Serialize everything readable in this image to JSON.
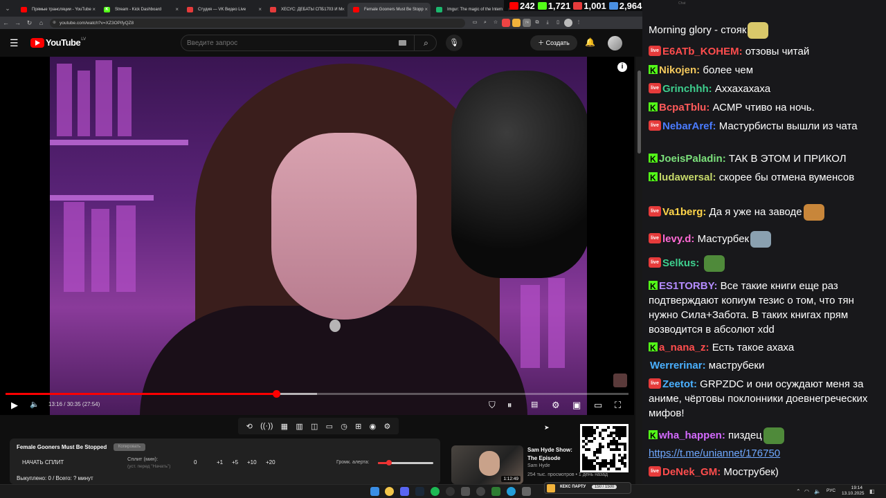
{
  "browser": {
    "tabs": [
      {
        "label": "Прямые трансляции - YouTube",
        "favicon_color": "#ff0000",
        "fav": ""
      },
      {
        "label": "Stream - Kick Dashboard",
        "favicon_color": "#53fc18",
        "fav": "K"
      },
      {
        "label": "Студия — VK Видео Live",
        "favicon_color": "#e63b3b",
        "fav": ""
      },
      {
        "label": "ХЕСУС: ДЕБАТЫ СПБ1703 И М",
        "favicon_color": "#e63b3b",
        "fav": ""
      },
      {
        "label": "Female Gooners Must Be Stopp",
        "favicon_color": "#ff0000",
        "fav": ""
      },
      {
        "label": "Imgur: The magic of the Intern",
        "favicon_color": "#1bb76e",
        "fav": ""
      }
    ],
    "url": "youtube.com/watch?v=XZ3OPifyQZ8",
    "ext_badge": "74"
  },
  "youtube": {
    "logo": "YouTube",
    "country": "LV",
    "search_placeholder": "Введите запрос",
    "create_label": "Создать",
    "player": {
      "time_label": "13:16 / 30:35 (27:54)",
      "played_fraction": 0.434,
      "loaded_fraction": 0.5
    }
  },
  "below": {
    "title": "Female Gooners Must Be Stopped",
    "title_btn": "Копировать",
    "split_start": "НАЧАТЬ СПЛИТ",
    "split_label": "Сплит (мин):",
    "split_sub": "(уст. перед \"Начать\")",
    "split_value": "0",
    "increments": [
      "+1",
      "+5",
      "+10",
      "+20"
    ],
    "alert_label": "Громк. алерта:",
    "alert_fraction": 0.2,
    "wasted": "Выкуплено: 0 / Всего: ? минут"
  },
  "recommended": {
    "title": "Sam Hyde Show: The Episode",
    "channel": "Sam Hyde",
    "meta": "254 тыс. просмотров • 1 день назад",
    "duration": "1:12:49"
  },
  "stats": [
    {
      "platform": "youtube",
      "color": "#ff0000",
      "value": "242"
    },
    {
      "platform": "kick",
      "color": "#53fc18",
      "value": "1,721"
    },
    {
      "platform": "vk",
      "color": "#e63b3b",
      "value": "1,001"
    },
    {
      "platform": "total",
      "color": "#4a90e2",
      "value": "2,964"
    }
  ],
  "chat": {
    "title": "Chat",
    "messages": [
      {
        "platform": "none",
        "user": "",
        "color": "#ffffff",
        "text": "Morning glory - стояк",
        "emote": "#d9c86a"
      },
      {
        "platform": "vk",
        "user": "E6ATb_KOHEM:",
        "color": "#ff4d4d",
        "text": " отзовы читай",
        "emote": ""
      },
      {
        "platform": "kick",
        "user": "Nikojen:",
        "color": "#f4c95d",
        "text": " более чем",
        "emote": ""
      },
      {
        "platform": "vk",
        "user": "Grinchhh:",
        "color": "#3ecf8e",
        "text": " Аххахахаха",
        "emote": ""
      },
      {
        "platform": "kick",
        "user": "BcpaTblu:",
        "color": "#ff5a5a",
        "text": " АСМР чтиво на ночь.",
        "emote": ""
      },
      {
        "platform": "vk",
        "user": "NebarAref:",
        "color": "#4a7bff",
        "text": " Мастурбисты вышли из чата",
        "emote": ""
      },
      {
        "platform": "kick",
        "user": "JoeisPaladin:",
        "color": "#7be07b",
        "text": " ТАК В ЭТОМ И ПРИКОЛ",
        "emote": ""
      },
      {
        "platform": "kick",
        "user": "ludawersal:",
        "color": "#c6d96a",
        "text": " скорее бы отмена вуменсов",
        "emote": ""
      },
      {
        "platform": "vk",
        "user": "Va1berg:",
        "color": "#ffd54a",
        "text": " Да я уже на заводе",
        "emote": "#c8863a"
      },
      {
        "platform": "vk",
        "user": "levy.d:",
        "color": "#ff6ad5",
        "text": " Мастурбек",
        "emote": "#8aa0b0"
      },
      {
        "platform": "vk",
        "user": "Selkus:",
        "color": "#3ecf8e",
        "text": " ",
        "emote": "#4f8a3a"
      },
      {
        "platform": "kick",
        "user": "ES1TORBY:",
        "color": "#b48cff",
        "text": " Все такие книги еще раз подтверждают копиум тезис о том, что тян нужно Сила+Забота. В таких книгах прям возводится в абсолют xdd",
        "emote": ""
      },
      {
        "platform": "kick",
        "user": "a_nana_z:",
        "color": "#ff4d4d",
        "text": " Есть такое ахаха",
        "emote": ""
      },
      {
        "platform": "youtube",
        "user": "Werrerinar:",
        "color": "#4ab0ff",
        "text": " маструбеки",
        "emote": ""
      },
      {
        "platform": "vk",
        "user": "Zeetot:",
        "color": "#4ab0ff",
        "text": " GRPZDC и они осуждают меня за аниме, чёртовы поклонники доевнегреческих мифов!",
        "emote": ""
      },
      {
        "platform": "kick",
        "user": "wha_happen:",
        "color": "#d46aff",
        "text": " пиздец",
        "emote": "#4f8a3a"
      },
      {
        "platform": "none",
        "user": "",
        "color": "#6fa8ff",
        "text": "https://t.me/uniannet/176750",
        "emote": ""
      },
      {
        "platform": "vk",
        "user": "DeNek_GM:",
        "color": "#ff4d4d",
        "text": " Мострубек)",
        "emote": ""
      }
    ]
  },
  "taskbar": {
    "kick_widget_label": "КЕКС ПАРТУ",
    "kick_widget_count": "150 / 1500",
    "lang": "РУС",
    "time": "19:14",
    "date": "13.10.2025"
  }
}
